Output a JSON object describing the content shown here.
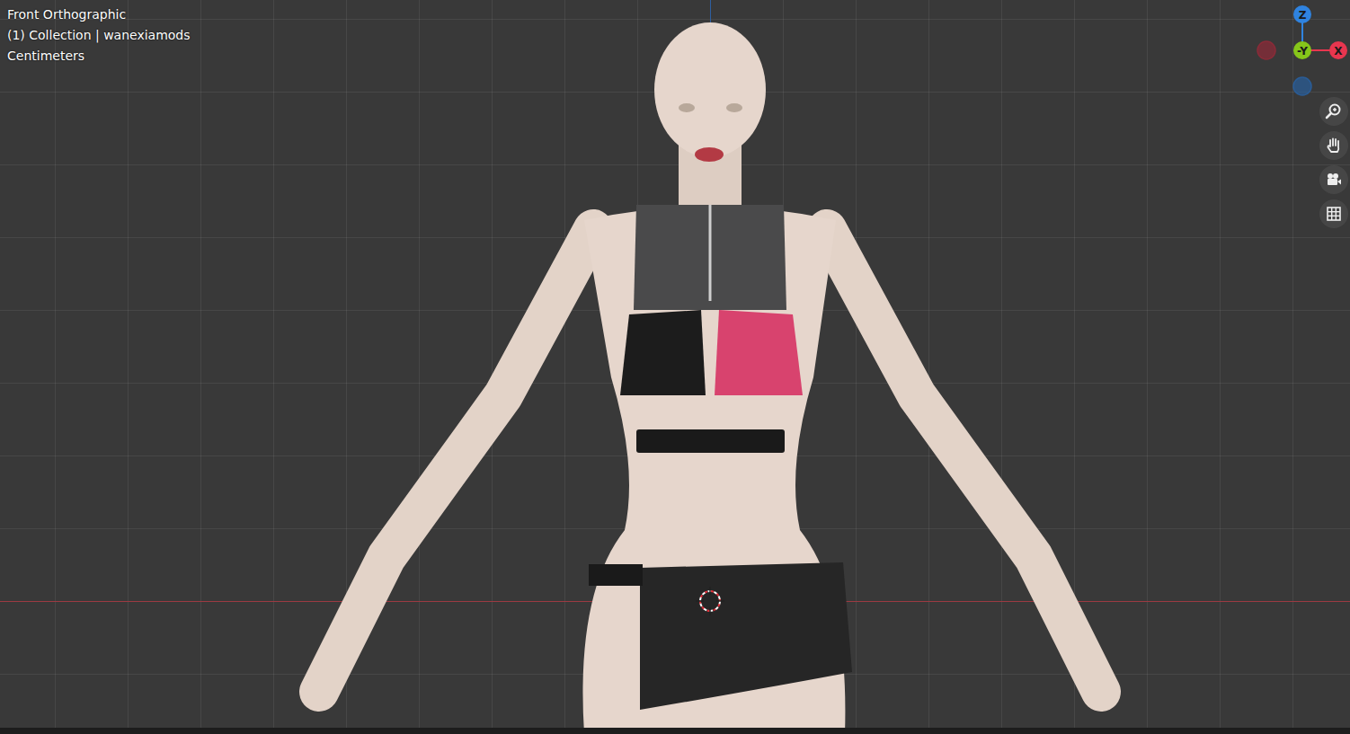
{
  "viewport": {
    "view_name": "Front Orthographic",
    "collection": "(1) Collection | wanexiamods",
    "units": "Centimeters"
  },
  "gizmo": {
    "axes": [
      {
        "label": "Z",
        "kind": "positive",
        "color": "#2f83e0",
        "x": 0,
        "y": -40
      },
      {
        "label": "X",
        "kind": "positive",
        "color": "#e8364f",
        "x": 40,
        "y": 0
      },
      {
        "label": "",
        "kind": "negative",
        "color": "#8a2b38",
        "x": -40,
        "y": 0
      },
      {
        "label": "",
        "kind": "negative",
        "color": "#2a5c96",
        "x": 0,
        "y": 40
      }
    ],
    "center": {
      "label": "-Y",
      "color": "#86c61a"
    }
  },
  "nav_tools": [
    {
      "name": "zoom"
    },
    {
      "name": "pan"
    },
    {
      "name": "camera"
    },
    {
      "name": "grid"
    }
  ]
}
